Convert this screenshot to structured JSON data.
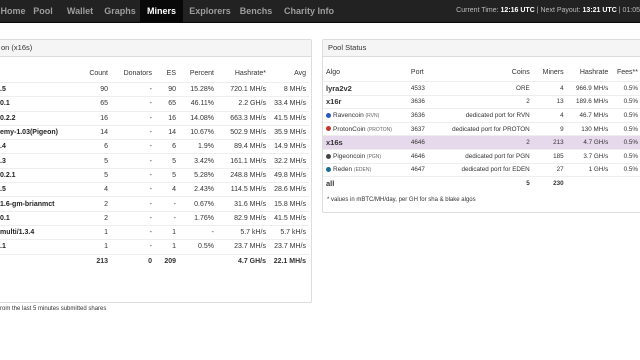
{
  "nav": {
    "items": [
      "Home",
      "Pool",
      "Wallet",
      "Graphs",
      "Miners",
      "Explorers",
      "Benchs",
      "Charity Info"
    ],
    "active_index": 4,
    "current_time_label": "Current Time:",
    "current_time": "12:16 UTC",
    "separator": "|",
    "next_payout_label": "Next Payout:",
    "next_payout": "13:21 UTC",
    "extra": "| 01:05"
  },
  "miners_panel": {
    "title": "on (x16s)",
    "columns": [
      "",
      "Count",
      "Donators",
      "ES",
      "Percent",
      "Hashrate*",
      "Avg"
    ],
    "rows": [
      {
        "name": ".5",
        "count": "90",
        "donators": "-",
        "es": "90",
        "percent": "15.28%",
        "hashrate": "720.1 MH/s",
        "avg": "8 MH/s"
      },
      {
        "name": "0.1",
        "count": "65",
        "donators": "-",
        "es": "65",
        "percent": "46.11%",
        "hashrate": "2.2 GH/s",
        "avg": "33.4 MH/s"
      },
      {
        "name": "0.2.2",
        "count": "16",
        "donators": "-",
        "es": "16",
        "percent": "14.08%",
        "hashrate": "663.3 MH/s",
        "avg": "41.5 MH/s"
      },
      {
        "name": "emy-1.03(Pigeon)",
        "count": "14",
        "donators": "-",
        "es": "14",
        "percent": "10.67%",
        "hashrate": "502.9 MH/s",
        "avg": "35.9 MH/s"
      },
      {
        "name": ".4",
        "count": "6",
        "donators": "-",
        "es": "6",
        "percent": "1.9%",
        "hashrate": "89.4 MH/s",
        "avg": "14.9 MH/s"
      },
      {
        "name": ".3",
        "count": "5",
        "donators": "-",
        "es": "5",
        "percent": "3.42%",
        "hashrate": "161.1 MH/s",
        "avg": "32.2 MH/s"
      },
      {
        "name": "0.2.1",
        "count": "5",
        "donators": "-",
        "es": "5",
        "percent": "5.28%",
        "hashrate": "248.8 MH/s",
        "avg": "49.8 MH/s"
      },
      {
        "name": ".5",
        "count": "4",
        "donators": "-",
        "es": "4",
        "percent": "2.43%",
        "hashrate": "114.5 MH/s",
        "avg": "28.6 MH/s"
      },
      {
        "name": "1.6-gm-brianmct",
        "count": "2",
        "donators": "-",
        "es": "-",
        "percent": "0.67%",
        "hashrate": "31.6 MH/s",
        "avg": "15.8 MH/s"
      },
      {
        "name": "0.1",
        "count": "2",
        "donators": "-",
        "es": "-",
        "percent": "1.76%",
        "hashrate": "82.9 MH/s",
        "avg": "41.5 MH/s"
      },
      {
        "name": "multi/1.3.4",
        "count": "1",
        "donators": "-",
        "es": "1",
        "percent": "-",
        "hashrate": "5.7 kH/s",
        "avg": "5.7 kH/s"
      },
      {
        "name": ".1",
        "count": "1",
        "donators": "-",
        "es": "1",
        "percent": "0.5%",
        "hashrate": "23.7 MH/s",
        "avg": "23.7 MH/s"
      }
    ],
    "total": {
      "name": "",
      "count": "213",
      "donators": "0",
      "es": "209",
      "percent": "",
      "hashrate": "4.7 GH/s",
      "avg": "22.1 MH/s"
    },
    "footnote": "rom the last 5 minutes submitted shares"
  },
  "pool_panel": {
    "title": "Pool Status",
    "columns": [
      "Algo",
      "Port",
      "Coins",
      "Miners",
      "Hashrate",
      "Fees**"
    ],
    "rows": [
      {
        "algo": "lyra2v2",
        "port": "4533",
        "coins": "ORE",
        "miners": "4",
        "hashrate": "966.9 MH/s",
        "fees": "0.5%",
        "type": "algo"
      },
      {
        "algo": "x16r",
        "port": "3636",
        "coins": "2",
        "miners": "13",
        "hashrate": "189.6 MH/s",
        "fees": "0.5%",
        "type": "algo"
      },
      {
        "algo": "Ravencoin",
        "tag": "(RVN)",
        "port": "3636",
        "coins": "dedicated port for RVN",
        "miners": "4",
        "hashrate": "46.7 MH/s",
        "fees": "0.5%",
        "type": "coin",
        "color": "#2b59c3"
      },
      {
        "algo": "ProtonCoin",
        "tag": "(PROTON)",
        "port": "3637",
        "coins": "dedicated port for PROTON",
        "miners": "9",
        "hashrate": "130 MH/s",
        "fees": "0.5%",
        "type": "coin",
        "color": "#c0392b"
      },
      {
        "algo": "x16s",
        "port": "4646",
        "coins": "2",
        "miners": "213",
        "hashrate": "4.7 GH/s",
        "fees": "0.5%",
        "type": "highlight"
      },
      {
        "algo": "Pigeoncoin",
        "tag": "(PGN)",
        "port": "4646",
        "coins": "dedicated port for PGN",
        "miners": "185",
        "hashrate": "3.7 GH/s",
        "fees": "0.5%",
        "type": "coin",
        "color": "#444444"
      },
      {
        "algo": "Reden",
        "tag": "(EDEN)",
        "port": "4647",
        "coins": "dedicated port for EDEN",
        "miners": "27",
        "hashrate": "1 GH/s",
        "fees": "0.5%",
        "type": "coin",
        "color": "#1b6e8f"
      },
      {
        "algo": "all",
        "port": "",
        "coins": "5",
        "miners": "230",
        "hashrate": "",
        "fees": "",
        "type": "all"
      }
    ],
    "footnote": "* values in mBTC/MH/day, per GH for sha & blake algos"
  }
}
